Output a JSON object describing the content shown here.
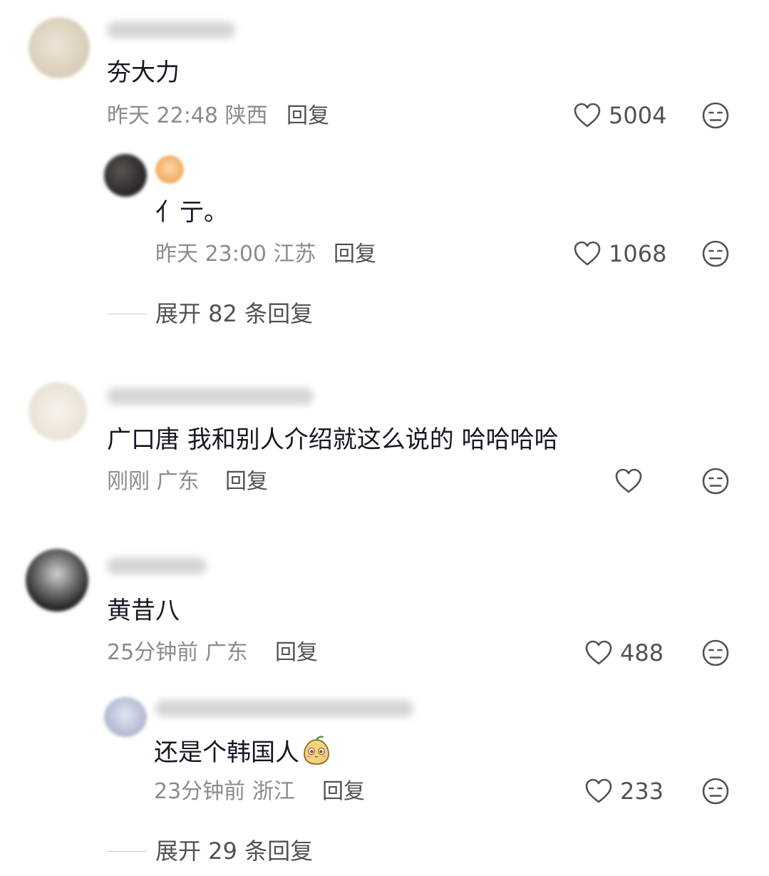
{
  "comments": [
    {
      "text": "夯大力",
      "time": "昨天 22:48",
      "location": "陕西",
      "reply_label": "回复",
      "likes": "5004",
      "replies": [
        {
          "text": "亻亍。",
          "time": "昨天 23:00",
          "location": "江苏",
          "reply_label": "回复",
          "likes": "1068"
        }
      ],
      "expand_label": "展开 82 条回复"
    },
    {
      "text": "广口唐 我和别人介绍就这么说的 哈哈哈哈",
      "time": "刚刚",
      "location": "广东",
      "reply_label": "回复",
      "likes": ""
    },
    {
      "text": "黄昔八",
      "time": "25分钟前",
      "location": "广东",
      "reply_label": "回复",
      "likes": "488",
      "replies": [
        {
          "text": "还是个韩国人",
          "emoji": "shy-face-emoji",
          "time": "23分钟前",
          "location": "浙江",
          "reply_label": "回复",
          "likes": "233"
        }
      ],
      "expand_label": "展开 29 条回复"
    }
  ],
  "icons": {
    "like": "heart-outline-icon",
    "dislike": "unhappy-face-icon"
  },
  "colors": {
    "text_primary": "#161823",
    "text_meta": "#8a8b91",
    "text_secondary": "#505258"
  }
}
